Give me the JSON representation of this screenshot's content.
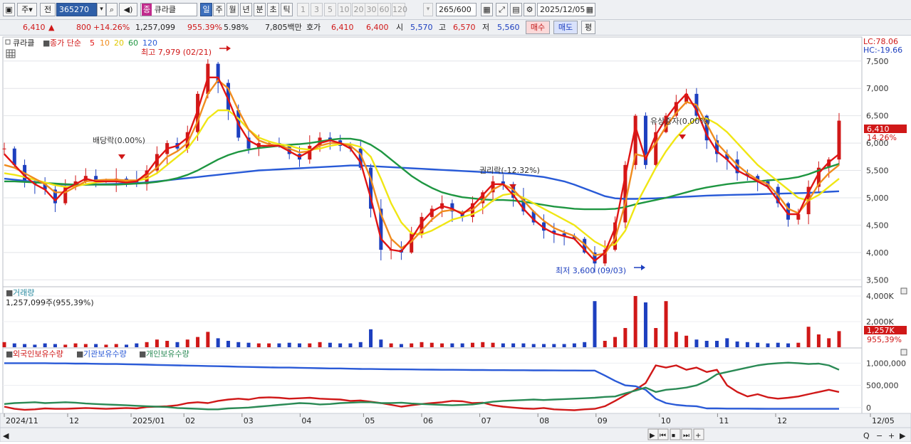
{
  "toolbar": {
    "type_label": "주",
    "scope_label": "전",
    "code": "365270",
    "badge": "종",
    "stock_name": "큐라클",
    "periods": [
      "일",
      "주",
      "월",
      "년",
      "분",
      "초",
      "틱"
    ],
    "intervals": [
      "1",
      "3",
      "5",
      "10",
      "20",
      "30",
      "60",
      "120"
    ],
    "count_value": "265",
    "count_total": "/600",
    "date": "2025/12/05"
  },
  "pricebar": {
    "price": "6,410",
    "arrow": "▲",
    "change": "800",
    "change_pct": "+14.26%",
    "volume": "1,257,099",
    "volume_pct": "955.39%",
    "turnover_pct": "5.98%",
    "amount": "7,805백만",
    "quote_label": "호가",
    "ask": "6,410",
    "bid": "6,400",
    "open_label": "시",
    "open": "5,570",
    "high_label": "고",
    "high": "6,570",
    "low_label": "저",
    "low": "5,560",
    "buy_button": "매수",
    "sell_button": "매도",
    "eval_button": "평"
  },
  "colors": {
    "up": "#d01818",
    "down": "#1d3fbf",
    "ma5": "#e01414",
    "ma10": "#f08c1e",
    "ma20": "#f0e614",
    "ma60": "#1e9641",
    "ma120": "#285ad7",
    "foreign": "#d01818",
    "institution": "#2a5ad7",
    "individual": "#2a8a55"
  },
  "chart_data": [
    {
      "type": "candlestick",
      "legend": {
        "name": "큐라클",
        "basis": "종가 단순",
        "ma_periods": [
          "5",
          "10",
          "20",
          "60",
          "120"
        ]
      },
      "lc_label": "LC:78.06",
      "hc_label": "HC:-19.66",
      "current_label": "6,410",
      "current_pct": "14.26%",
      "ylim": [
        3400,
        7900
      ],
      "yticks": [
        "3,500",
        "4,000",
        "4,500",
        "5,000",
        "5,500",
        "6,000",
        "6,500",
        "7,000",
        "7,500"
      ],
      "ytick_values": [
        3500,
        4000,
        4500,
        5000,
        5500,
        6000,
        6500,
        7000,
        7500
      ],
      "annotations": [
        {
          "text": "최고 7,979 (02/21)",
          "date": "2025/02/21",
          "value": 7979
        },
        {
          "text": "최저 3,600 (09/03)",
          "date": "2025/09/03",
          "value": 3600
        },
        {
          "text": "배당락(0.00%)",
          "date": "2024/12/26"
        },
        {
          "text": "권리락(-12.32%)",
          "date": "2025/07/01"
        },
        {
          "text": "유상증자(0.00%)",
          "date": "2025/09/26"
        }
      ],
      "series": [
        {
          "name": "종가",
          "values": [
            5900,
            5600,
            5300,
            5250,
            5150,
            4900,
            5200,
            5300,
            5400,
            5300,
            5300,
            5350,
            5300,
            5250,
            5500,
            5800,
            6000,
            5900,
            6200,
            6900,
            7450,
            7100,
            6600,
            6100,
            5900,
            6000,
            6000,
            5950,
            5800,
            5700,
            5950,
            6100,
            6050,
            5950,
            5900,
            5550,
            4800,
            4050,
            4050,
            4000,
            4350,
            4650,
            4800,
            4900,
            4750,
            4650,
            4900,
            5100,
            5300,
            5250,
            5000,
            4750,
            4550,
            4400,
            4350,
            4300,
            4250,
            4000,
            3800,
            4050,
            4550,
            5600,
            6500,
            5600,
            6200,
            6500,
            6750,
            6900,
            6500,
            6050,
            5800,
            5700,
            5450,
            5400,
            5300,
            5200,
            4900,
            4600,
            4700,
            5200,
            5550,
            5700,
            6410
          ]
        },
        {
          "name": "MA5",
          "values": [
            5800,
            5600,
            5400,
            5250,
            5150,
            4950,
            5150,
            5250,
            5350,
            5300,
            5300,
            5300,
            5280,
            5300,
            5450,
            5700,
            5900,
            5950,
            6100,
            6600,
            7200,
            7200,
            6800,
            6350,
            6050,
            5950,
            5950,
            5950,
            5850,
            5750,
            5850,
            6000,
            6050,
            6000,
            5900,
            5650,
            5000,
            4250,
            4050,
            4020,
            4250,
            4550,
            4750,
            4850,
            4800,
            4700,
            4850,
            5050,
            5250,
            5250,
            5050,
            4800,
            4600,
            4450,
            4350,
            4300,
            4250,
            4050,
            3850,
            4000,
            4450,
            5400,
            6300,
            5700,
            6150,
            6450,
            6700,
            6900,
            6600,
            6150,
            5850,
            5700,
            5500,
            5400,
            5300,
            5200,
            4950,
            4700,
            4700,
            5100,
            5450,
            5650,
            5800
          ]
        },
        {
          "name": "MA10",
          "values": [
            5600,
            5550,
            5450,
            5350,
            5250,
            5100,
            5100,
            5200,
            5300,
            5320,
            5330,
            5330,
            5320,
            5320,
            5400,
            5550,
            5750,
            5850,
            6000,
            6400,
            6900,
            7150,
            7000,
            6600,
            6250,
            6050,
            5980,
            5950,
            5900,
            5830,
            5850,
            5950,
            6000,
            6000,
            5950,
            5800,
            5350,
            4700,
            4250,
            4080,
            4200,
            4400,
            4600,
            4750,
            4780,
            4730,
            4780,
            4950,
            5150,
            5250,
            5150,
            4950,
            4750,
            4580,
            4450,
            4370,
            4300,
            4150,
            3950,
            3980,
            4250,
            4900,
            5800,
            5750,
            6000,
            6300,
            6550,
            6750,
            6700,
            6350,
            6000,
            5800,
            5600,
            5450,
            5330,
            5250,
            5050,
            4800,
            4720,
            4950,
            5250,
            5450,
            5600
          ]
        },
        {
          "name": "MA20",
          "values": [
            5450,
            5420,
            5380,
            5330,
            5280,
            5230,
            5200,
            5210,
            5250,
            5280,
            5300,
            5310,
            5310,
            5310,
            5350,
            5450,
            5600,
            5750,
            5900,
            6150,
            6450,
            6600,
            6600,
            6450,
            6250,
            6100,
            6030,
            5980,
            5950,
            5900,
            5880,
            5900,
            5950,
            5980,
            5980,
            5930,
            5750,
            5350,
            4900,
            4550,
            4350,
            4330,
            4400,
            4500,
            4600,
            4650,
            4700,
            4800,
            4950,
            5050,
            5080,
            5000,
            4900,
            4800,
            4700,
            4600,
            4500,
            4350,
            4200,
            4100,
            4150,
            4400,
            4850,
            5200,
            5550,
            5850,
            6100,
            6300,
            6450,
            6450,
            6350,
            6200,
            6000,
            5800,
            5600,
            5450,
            5300,
            5150,
            5000,
            4950,
            5050,
            5200,
            5350
          ]
        },
        {
          "name": "MA60",
          "values": [
            5300,
            5300,
            5290,
            5280,
            5270,
            5260,
            5250,
            5240,
            5240,
            5240,
            5240,
            5240,
            5250,
            5260,
            5270,
            5290,
            5320,
            5360,
            5420,
            5500,
            5600,
            5700,
            5780,
            5840,
            5880,
            5910,
            5930,
            5950,
            5970,
            5980,
            6000,
            6030,
            6060,
            6080,
            6080,
            6050,
            5970,
            5850,
            5700,
            5550,
            5400,
            5280,
            5180,
            5100,
            5050,
            5010,
            4990,
            4970,
            4960,
            4960,
            4950,
            4930,
            4900,
            4870,
            4840,
            4820,
            4800,
            4790,
            4790,
            4790,
            4800,
            4830,
            4880,
            4920,
            4960,
            5000,
            5050,
            5100,
            5150,
            5190,
            5220,
            5250,
            5270,
            5290,
            5300,
            5320,
            5330,
            5350,
            5380,
            5430,
            5500,
            5560,
            5620
          ]
        },
        {
          "name": "MA120",
          "values": [
            5350,
            5330,
            5310,
            5290,
            5270,
            5250,
            5240,
            5240,
            5240,
            5245,
            5250,
            5255,
            5260,
            5270,
            5280,
            5300,
            5320,
            5340,
            5360,
            5380,
            5400,
            5420,
            5440,
            5460,
            5480,
            5500,
            5510,
            5520,
            5530,
            5540,
            5550,
            5560,
            5570,
            5580,
            5590,
            5590,
            5580,
            5570,
            5560,
            5550,
            5540,
            5530,
            5520,
            5510,
            5500,
            5490,
            5480,
            5470,
            5460,
            5450,
            5440,
            5420,
            5400,
            5380,
            5340,
            5300,
            5240,
            5170,
            5100,
            5030,
            4990,
            4980,
            4980,
            4985,
            4990,
            5000,
            5010,
            5020,
            5030,
            5040,
            5045,
            5050,
            5055,
            5060,
            5065,
            5070,
            5075,
            5080,
            5085,
            5090,
            5100,
            5110,
            5120
          ]
        }
      ]
    },
    {
      "type": "bar",
      "title": "거래량",
      "value_label": "1,257,099주(955,39%)",
      "ylim": [
        0,
        4500
      ],
      "yticks": [
        "2,000K",
        "4,000K"
      ],
      "ytick_values": [
        2000,
        4000
      ],
      "current_label": "1,257K",
      "current_pct": "955,39%",
      "values": [
        400,
        300,
        250,
        200,
        300,
        250,
        200,
        300,
        250,
        250,
        200,
        250,
        200,
        300,
        400,
        600,
        500,
        400,
        600,
        800,
        1200,
        700,
        500,
        400,
        350,
        300,
        300,
        300,
        350,
        300,
        300,
        400,
        350,
        300,
        300,
        400,
        1400,
        600,
        300,
        250,
        300,
        400,
        350,
        300,
        300,
        300,
        350,
        400,
        350,
        300,
        300,
        300,
        250,
        250,
        250,
        250,
        300,
        400,
        3600,
        500,
        800,
        1500,
        4000,
        3500,
        1500,
        3600,
        1200,
        900,
        600,
        500,
        500,
        700,
        450,
        400,
        350,
        300,
        350,
        300,
        350,
        1600,
        1000,
        700,
        1257
      ]
    },
    {
      "type": "line",
      "legend": [
        "외국인보유수량",
        "기관보유수량",
        "개인보유수량"
      ],
      "ylim": [
        -100000,
        1150000
      ],
      "yticks": [
        "0",
        "500,000",
        "1,000,000"
      ],
      "ytick_values": [
        0,
        500000,
        1000000
      ],
      "series": [
        {
          "name": "외국인보유수량",
          "values": [
            20000,
            -30000,
            -50000,
            -40000,
            -20000,
            -30000,
            -30000,
            -20000,
            -10000,
            -20000,
            -30000,
            -20000,
            -10000,
            -20000,
            10000,
            20000,
            30000,
            50000,
            100000,
            120000,
            100000,
            150000,
            180000,
            200000,
            180000,
            220000,
            230000,
            220000,
            200000,
            210000,
            220000,
            200000,
            190000,
            180000,
            150000,
            160000,
            130000,
            100000,
            60000,
            20000,
            50000,
            80000,
            100000,
            120000,
            150000,
            140000,
            100000,
            110000,
            50000,
            20000,
            0,
            -20000,
            -30000,
            -10000,
            -40000,
            -50000,
            -60000,
            -40000,
            -30000,
            30000,
            150000,
            280000,
            400000,
            550000,
            950000,
            900000,
            950000,
            850000,
            900000,
            800000,
            850000,
            500000,
            350000,
            250000,
            300000,
            230000,
            200000,
            220000,
            250000,
            300000,
            350000,
            400000,
            350000
          ]
        },
        {
          "name": "기관보유수량",
          "values": [
            1000000,
            1000000,
            1000000,
            1000000,
            1000000,
            995000,
            995000,
            990000,
            990000,
            985000,
            980000,
            980000,
            975000,
            970000,
            965000,
            960000,
            955000,
            950000,
            945000,
            940000,
            935000,
            930000,
            925000,
            920000,
            915000,
            910000,
            905000,
            900000,
            900000,
            895000,
            890000,
            885000,
            880000,
            880000,
            875000,
            870000,
            868000,
            865000,
            862000,
            860000,
            858000,
            855000,
            853000,
            850000,
            850000,
            848000,
            846000,
            845000,
            843000,
            842000,
            840000,
            840000,
            838000,
            837000,
            836000,
            835000,
            834000,
            833000,
            832000,
            720000,
            600000,
            500000,
            480000,
            400000,
            200000,
            100000,
            60000,
            40000,
            30000,
            -20000,
            -20000,
            -25000,
            -25000,
            -25000,
            -28000,
            -30000,
            -30000,
            -30000,
            -30000,
            -30000,
            -30000,
            -30000,
            -30000
          ]
        },
        {
          "name": "개인보유수량",
          "values": [
            80000,
            100000,
            110000,
            120000,
            100000,
            110000,
            120000,
            110000,
            90000,
            80000,
            70000,
            60000,
            50000,
            40000,
            30000,
            20000,
            10000,
            -10000,
            -20000,
            -30000,
            -40000,
            -40000,
            -20000,
            -10000,
            0,
            20000,
            40000,
            60000,
            80000,
            100000,
            90000,
            70000,
            80000,
            100000,
            110000,
            120000,
            120000,
            100000,
            100000,
            110000,
            90000,
            80000,
            70000,
            60000,
            50000,
            60000,
            70000,
            100000,
            130000,
            150000,
            160000,
            170000,
            180000,
            170000,
            180000,
            190000,
            200000,
            210000,
            220000,
            240000,
            250000,
            320000,
            380000,
            450000,
            350000,
            400000,
            420000,
            450000,
            500000,
            600000,
            750000,
            800000,
            850000,
            900000,
            950000,
            980000,
            1000000,
            1010000,
            1000000,
            980000,
            990000,
            950000,
            850000
          ]
        }
      ]
    }
  ],
  "x_axis": {
    "labels": [
      "2024/11",
      "12",
      "2025/01",
      "02",
      "03",
      "04",
      "05",
      "06",
      "07",
      "08",
      "09",
      "10",
      "11",
      "12",
      "12/05"
    ],
    "label_index": [
      0,
      12,
      24,
      34,
      45,
      56,
      68,
      79,
      90,
      101,
      112,
      124,
      135,
      146,
      158
    ]
  },
  "nav": {
    "buttons": [
      "▶",
      "⏮",
      "⏹",
      "⏭",
      "+"
    ],
    "icons": [
      "◀",
      "Q",
      "−",
      "+",
      "▶"
    ]
  }
}
